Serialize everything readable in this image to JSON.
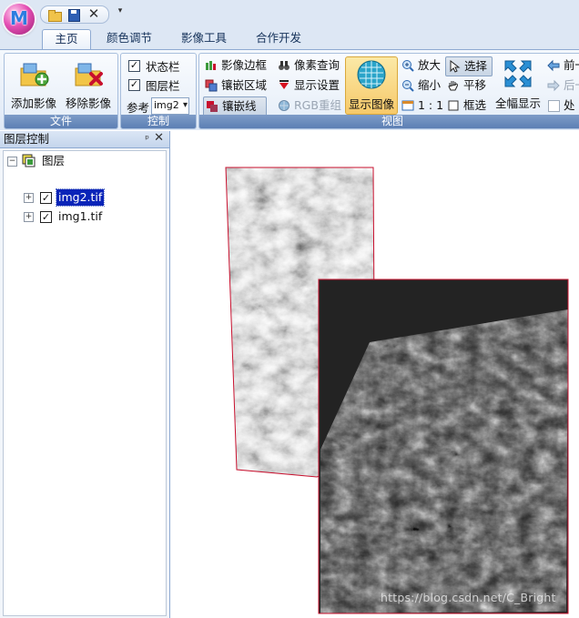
{
  "app": {
    "orb_letter": "M",
    "qat_close_symbol": "✕",
    "qat_more_symbol": "▾"
  },
  "tabs": [
    {
      "label": "主页",
      "active": true
    },
    {
      "label": "颜色调节",
      "active": false
    },
    {
      "label": "影像工具",
      "active": false
    },
    {
      "label": "合作开发",
      "active": false
    }
  ],
  "ribbon": {
    "file_group": {
      "title": "文件",
      "add_image": "添加影像",
      "remove_image": "移除影像"
    },
    "control_group": {
      "title": "控制",
      "status_bar": "状态栏",
      "layer_bar": "图层栏",
      "reference_label": "参考",
      "reference_value": "img2"
    },
    "view_group": {
      "title": "视图",
      "image_border": "影像边框",
      "mosaic_area": "镶嵌区域",
      "seamline": "镶嵌线",
      "pixel_query": "像素查询",
      "display_settings": "显示设置",
      "rgb_recombine": "RGB重组",
      "show_image": "显示图像",
      "zoom_in": "放大",
      "zoom_out": "缩小",
      "one_to_one": "1 : 1",
      "select": "选择",
      "pan": "平移",
      "box_select": "框选",
      "full_extent": "全幅显示",
      "prev": "前一",
      "next": "后一",
      "process": "处"
    }
  },
  "layer_panel": {
    "title": "图层控制",
    "pin_symbol": "ᵖ",
    "close_symbol": "✕",
    "root": {
      "label": "图层",
      "expander": "⊟"
    },
    "layers": [
      {
        "name": "img2.tif",
        "checked": true,
        "selected": true
      },
      {
        "name": "img1.tif",
        "checked": true,
        "selected": false
      }
    ]
  },
  "map": {
    "watermark": "https://blog.csdn.net/C_Bright"
  },
  "colors": {
    "accent": "#2f5fb3",
    "selection": "#0a24b8",
    "image_border": "#c8102e",
    "active_button": "#f7c96a"
  }
}
